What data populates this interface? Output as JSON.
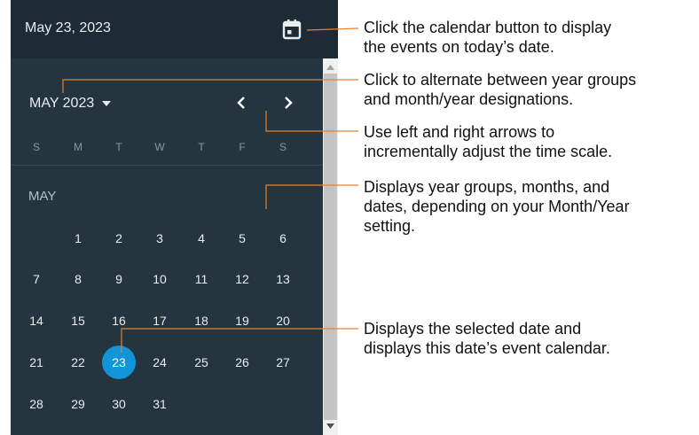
{
  "header": {
    "date": "May 23, 2023",
    "today_icon": "calendar-icon"
  },
  "nav": {
    "month_year": "MAY 2023",
    "caret_icon": "caret-down-icon",
    "prev_icon": "chevron-left-icon",
    "next_icon": "chevron-right-icon"
  },
  "weekdays": [
    "S",
    "M",
    "T",
    "W",
    "T",
    "F",
    "S"
  ],
  "month_label": "MAY",
  "weeks": [
    [
      "",
      "1",
      "2",
      "3",
      "4",
      "5",
      "6"
    ],
    [
      "7",
      "8",
      "9",
      "10",
      "11",
      "12",
      "13"
    ],
    [
      "14",
      "15",
      "16",
      "17",
      "18",
      "19",
      "20"
    ],
    [
      "21",
      "22",
      "23",
      "24",
      "25",
      "26",
      "27"
    ],
    [
      "28",
      "29",
      "30",
      "31",
      "",
      "",
      ""
    ]
  ],
  "selected_day": "23",
  "colors": {
    "panel": "#16232c",
    "body": "#243540",
    "selected": "#1295d8",
    "callout_line": "#e8802a"
  },
  "callouts": [
    [
      "Click the calendar button to display",
      "the events on today’s date."
    ],
    [
      "Click to alternate between year groups",
      "and month/year designations."
    ],
    [
      "Use left and right arrows to",
      "incrementally adjust the time scale."
    ],
    [
      "Displays year groups, months, and",
      "dates, depending on your Month/Year",
      "setting."
    ],
    [
      "Displays the selected date and",
      "displays this date’s event calendar."
    ]
  ]
}
